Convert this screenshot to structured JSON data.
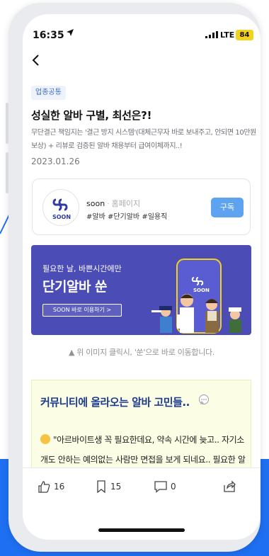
{
  "status_bar": {
    "time": "16:35",
    "network": "LTE",
    "battery": "84"
  },
  "article": {
    "category": "업종공통",
    "title": "성실한 알바 구별, 최선은?!",
    "description": "무단결근 책임지는 '결근 방지 시스템'(대체근무자 바로 보내주고, 안되면 10만원 보상) + 리뷰로 검증된 알바 채용부터 급여이체까지..!",
    "date": "2023.01.26"
  },
  "profile": {
    "logo_text": "SOON",
    "name": "soon",
    "separator": "·",
    "site": "홈페이지",
    "tags": "#알바 #단기알바 #일용직",
    "subscribe_label": "구독"
  },
  "banner": {
    "subtitle": "필요한 날, 바쁜시간에만",
    "title": "단기알바 쑨",
    "button_label": "SOON 바로 이용하기  >",
    "phone_text": "SOON"
  },
  "banner_caption": "▲ 위 이미지 클릭시, '쑨'으로 바로 이동합니다.",
  "community": {
    "title": "커뮤니티에 올라오는 알바 고민들..",
    "quote": "\"아르바이트생 꼭 필요한데요, 약속 시간에 늦고.. 자기소개도 안하는 예의없는 사람만 면접을 보게 되네요.. 필요한 알바생 구할 수 있을까요?\""
  },
  "actions": {
    "like_count": "16",
    "bookmark_count": "15",
    "comment_count": "0"
  },
  "colors": {
    "accent_blue": "#1f6ff2",
    "banner_purple": "#4b4cb6",
    "subscribe_blue": "#5ea3f0",
    "battery_yellow": "#f2d21b"
  }
}
